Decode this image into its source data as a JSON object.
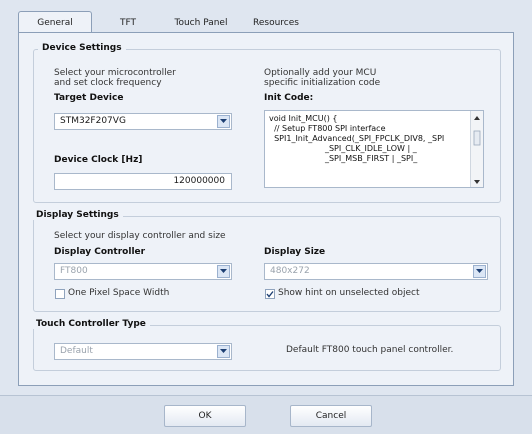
{
  "tabs": [
    "General",
    "TFT",
    "Touch Panel",
    "Resources"
  ],
  "device_settings": {
    "title": "Device Settings",
    "desc_left_1": "Select your microcontroller",
    "desc_left_2": "and set clock frequency",
    "desc_right_1": "Optionally add your MCU",
    "desc_right_2": "specific initialization code",
    "target_device_label": "Target Device",
    "target_device_value": "STM32F207VG",
    "init_code_label": "Init Code:",
    "init_code": "void Init_MCU() {\n  // Setup FT800 SPI interface\n  SPI1_Init_Advanced(_SPI_FPCLK_DIV8, _SPI\n                      _SPI_CLK_IDLE_LOW | _\n                      _SPI_MSB_FIRST | _SPI_",
    "device_clock_label": "Device Clock [Hz]",
    "device_clock_value": "120000000"
  },
  "display_settings": {
    "title": "Display Settings",
    "desc": "Select your display controller and size",
    "controller_label": "Display Controller",
    "controller_value": "FT800",
    "size_label": "Display Size",
    "size_value": "480x272",
    "one_pixel_label": "One Pixel Space Width",
    "one_pixel_checked": false,
    "show_hint_label": "Show hint on unselected object",
    "show_hint_checked": true
  },
  "touch_controller": {
    "title": "Touch Controller Type",
    "value": "Default",
    "description": "Default FT800 touch panel controller."
  },
  "buttons": {
    "ok": "OK",
    "cancel": "Cancel"
  }
}
